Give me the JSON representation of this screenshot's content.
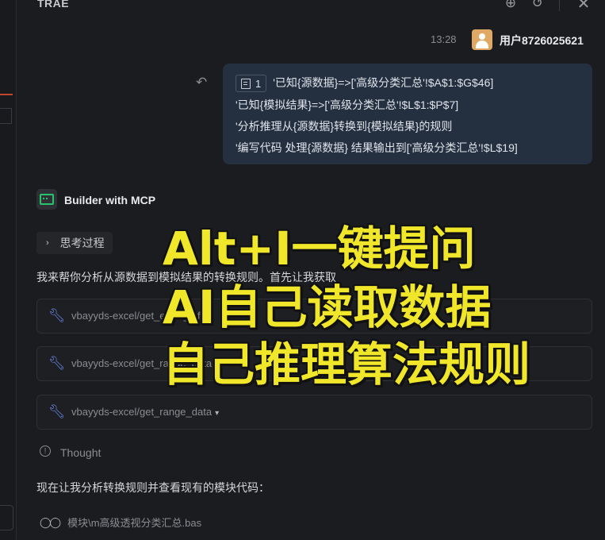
{
  "app": {
    "title": "TRAE"
  },
  "header": {
    "icons": [
      "new-chat-icon",
      "history-icon",
      "close-icon"
    ]
  },
  "message": {
    "time": "13:28",
    "username": "用户8726025621",
    "context_chip": "1",
    "lines": [
      "'已知{源数据}=>['高级分类汇总'!$A$1:$G$46]",
      "'已知{模拟结果}=>['高级分类汇总'!$L$1:$P$7]",
      "'分析推理从{源数据}转换到{模拟结果}的规则",
      "'编写代码 处理{源数据} 结果输出到['高级分类汇总'!$L$19]"
    ]
  },
  "agent": {
    "name": "Builder with MCP",
    "thinking_label": "思考过程",
    "intro": "我来帮你分析从源数据到模拟结果的转换规则。首先让我获取",
    "tools": [
      {
        "label": "vbayyds-excel/get_excel_info"
      },
      {
        "label": "vbayyds-excel/get_range_data"
      },
      {
        "label": "vbayyds-excel/get_range_data"
      }
    ],
    "thought_label": "Thought",
    "next": "现在让我分析转换规则并查看现有的模块代码：",
    "file": "模块\\m高级透视分类汇总.bas"
  },
  "overlay": {
    "lines": [
      "Alt+I一键提问",
      "AI自己读取数据",
      "自己推理算法规则"
    ],
    "color": "#f0e62a"
  }
}
